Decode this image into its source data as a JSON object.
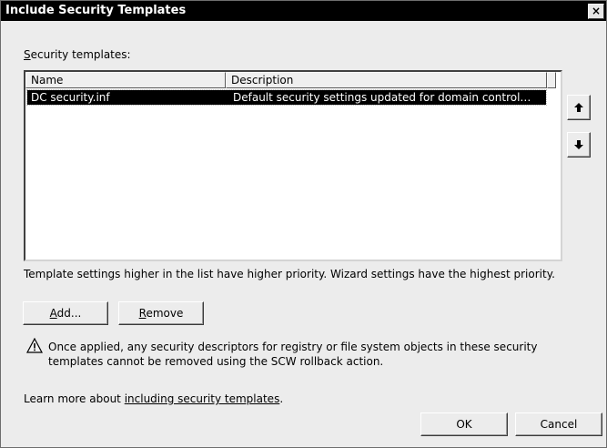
{
  "window": {
    "title": "Include Security Templates",
    "close_label": "×"
  },
  "templates": {
    "label_prefix": "",
    "label_accel": "S",
    "label_rest": "ecurity templates:",
    "columns": {
      "name": "Name",
      "description": "Description"
    },
    "rows": [
      {
        "name": "DC security.inf",
        "description": "Default security settings updated for domain control…"
      }
    ]
  },
  "priority_note": "Template settings higher in the list have higher priority. Wizard settings have the highest priority.",
  "buttons": {
    "add_accel": "A",
    "add_rest": "dd...",
    "remove_accel": "R",
    "remove_rest": "emove",
    "ok": "OK",
    "cancel": "Cancel",
    "move_up_icon": "arrow-up",
    "move_down_icon": "arrow-down"
  },
  "warning": {
    "icon": "warning-triangle",
    "line1": "Once applied, any security descriptors for registry or file system objects in these security",
    "line2": "templates cannot be removed using the SCW rollback action."
  },
  "learn_more": {
    "prefix": "Learn more about ",
    "link": "including security templates",
    "suffix": "."
  }
}
